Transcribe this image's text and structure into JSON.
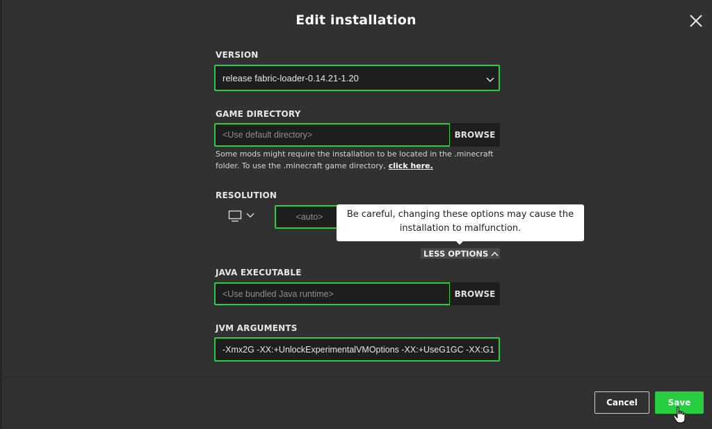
{
  "dialog": {
    "title": "Edit installation"
  },
  "version": {
    "label": "VERSION",
    "value": "release fabric-loader-0.14.21-1.20"
  },
  "game_directory": {
    "label": "GAME DIRECTORY",
    "placeholder": "<Use default directory>",
    "browse_label": "BROWSE",
    "helper_text": "Some mods might require the installation to be located in the .minecraft folder. To use the .minecraft game directory,",
    "helper_link": "click here."
  },
  "resolution": {
    "label": "RESOLUTION",
    "placeholder": "<auto>"
  },
  "tooltip": {
    "text": "Be careful, changing these options may cause the installation to malfunction."
  },
  "options_toggle": {
    "label": "LESS OPTIONS"
  },
  "java_executable": {
    "label": "JAVA EXECUTABLE",
    "placeholder": "<Use bundled Java runtime>",
    "browse_label": "BROWSE"
  },
  "jvm_arguments": {
    "label": "JVM ARGUMENTS",
    "value": "-Xmx2G -XX:+UnlockExperimentalVMOptions -XX:+UseG1GC -XX:G1"
  },
  "footer": {
    "cancel_label": "Cancel",
    "save_label": "Save"
  },
  "colors": {
    "accent": "#27ce40",
    "background": "#313131",
    "field_background": "#1e1e1e"
  },
  "icons": [
    "close-icon",
    "chevron-down-icon",
    "monitor-icon",
    "chevron-up-icon",
    "hand-pointer-cursor"
  ]
}
